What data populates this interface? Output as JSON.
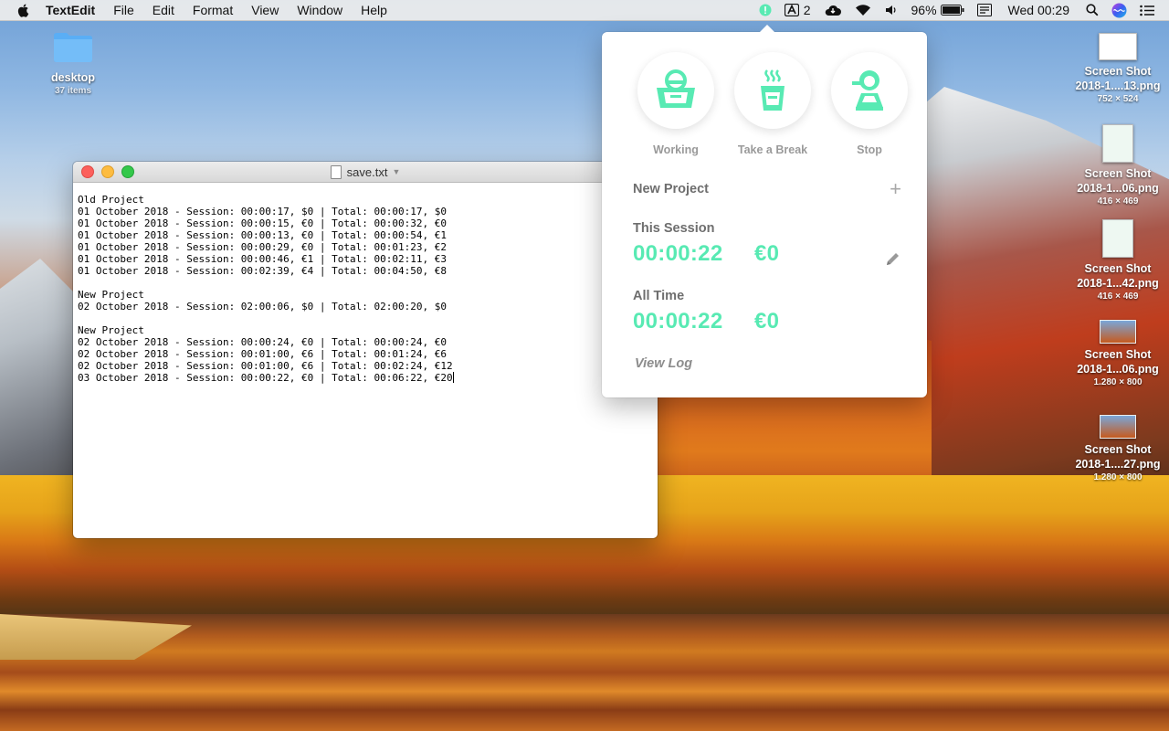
{
  "menubar": {
    "app_name": "TextEdit",
    "menus": [
      "File",
      "Edit",
      "Format",
      "View",
      "Window",
      "Help"
    ],
    "status": {
      "adobe_badge": "2",
      "battery": "96%",
      "clock": "Wed 00:29"
    }
  },
  "desktop_icons": [
    {
      "label": "desktop",
      "sub": "37 items",
      "type": "folder"
    },
    {
      "label": "Screen Shot 2018-1....13.png",
      "sub": "752 × 524"
    },
    {
      "label": "Screen Shot 2018-1...06.png",
      "sub": "416 × 469"
    },
    {
      "label": "Screen Shot 2018-1...42.png",
      "sub": "416 × 469"
    },
    {
      "label": "Screen Shot 2018-1...06.png",
      "sub": "1.280 × 800"
    },
    {
      "label": "Screen Shot 2018-1....27.png",
      "sub": "1.280 × 800"
    }
  ],
  "textedit": {
    "title": "save.txt",
    "lines": [
      "Old Project",
      "01 October 2018 - Session: 00:00:17, $0 | Total: 00:00:17, $0",
      "01 October 2018 - Session: 00:00:15, €0 | Total: 00:00:32, €0",
      "01 October 2018 - Session: 00:00:13, €0 | Total: 00:00:54, €1",
      "01 October 2018 - Session: 00:00:29, €0 | Total: 00:01:23, €2",
      "01 October 2018 - Session: 00:00:46, €1 | Total: 00:02:11, €3",
      "01 October 2018 - Session: 00:02:39, €4 | Total: 00:04:50, €8",
      "",
      "New Project",
      "02 October 2018 - Session: 02:00:06, $0 | Total: 02:00:20, $0",
      "",
      "New Project",
      "02 October 2018 - Session: 00:00:24, €0 | Total: 00:00:24, €0",
      "02 October 2018 - Session: 00:01:00, €6 | Total: 00:01:24, €6",
      "02 October 2018 - Session: 00:01:00, €6 | Total: 00:02:24, €12",
      "03 October 2018 - Session: 00:00:22, €0 | Total: 00:06:22, €20"
    ]
  },
  "popover": {
    "modes": [
      {
        "label": "Working",
        "icon": "basket-icon"
      },
      {
        "label": "Take a Break",
        "icon": "coffee-cup-icon"
      },
      {
        "label": "Stop",
        "icon": "person-stop-icon"
      }
    ],
    "project_name": "New Project",
    "this_session": {
      "label": "This Session",
      "time": "00:00:22",
      "money": "€0"
    },
    "all_time": {
      "label": "All Time",
      "time": "00:00:22",
      "money": "€0"
    },
    "view_log": "View Log",
    "accent_color": "#58eab3"
  }
}
